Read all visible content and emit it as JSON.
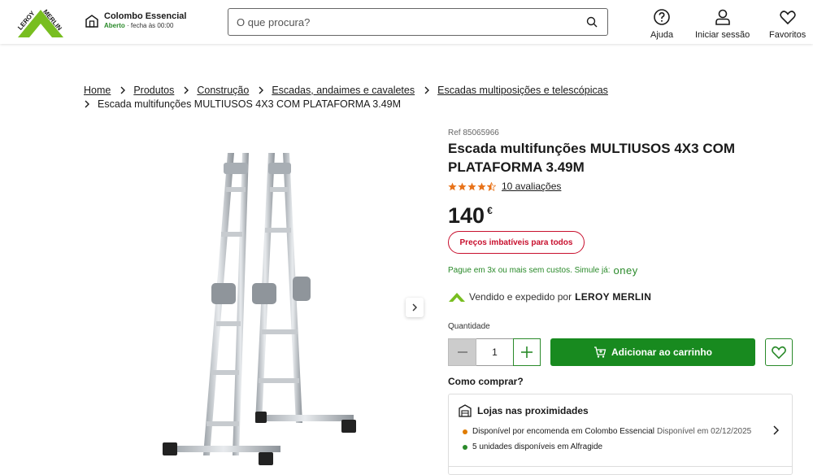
{
  "header": {
    "logo_text": "LEROY MERLIN",
    "store_name": "Colombo Essencial",
    "store_open": "Aberto",
    "store_hours": "· fecha às 00:00",
    "search_placeholder": "O que procura?",
    "help_label": "Ajuda",
    "login_label": "Iniciar sessão",
    "favorites_label": "Favoritos"
  },
  "breadcrumb": {
    "items": [
      "Home",
      "Produtos",
      "Construção",
      "Escadas, andaimes e cavaletes",
      "Escadas multiposições e telescópicas"
    ],
    "current": "Escada multifunções MULTIUSOS 4X3 COM PLATAFORMA 3.49M"
  },
  "product": {
    "ref": "Ref 85065966",
    "title": "Escada multifunções MULTIUSOS 4X3 COM PLATAFORMA 3.49M",
    "rating": 4.5,
    "reviews": "10 avaliações",
    "price": "140",
    "currency": "€",
    "promo": "Preços imbatíveis para todos",
    "installment_text": "Pague em 3x ou mais sem custos. Simule já:",
    "installment_brand": "oney",
    "seller_text": "Vendido e expedido por",
    "seller_name": "LEROY MERLIN",
    "quantity_label": "Quantidade",
    "quantity_value": "1",
    "add_to_cart": "Adicionar ao carrinho",
    "how_to_buy": "Como comprar?"
  },
  "availability": {
    "title": "Lojas nas proximidades",
    "lines": [
      {
        "status": "Disponível por encomenda em Colombo Essencial",
        "detail": "Disponível em 02/12/2025",
        "color": "#e07b00"
      },
      {
        "status": "5 unidades disponíveis em Alfragide",
        "detail": "",
        "color": "#2a8a2a"
      }
    ]
  },
  "colors": {
    "brand_green": "#188a1f",
    "promo_red": "#c8102e",
    "star_orange": "#e8731a"
  }
}
